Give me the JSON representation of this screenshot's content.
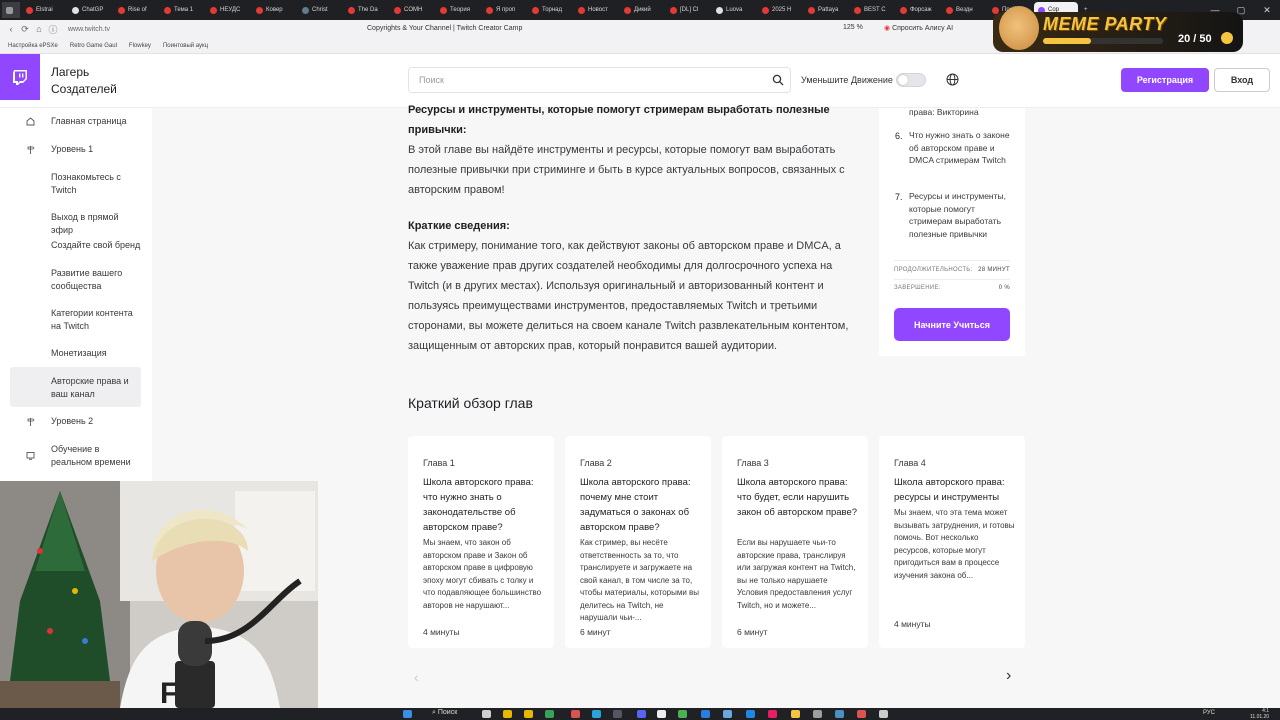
{
  "browser": {
    "tabs": [
      {
        "label": "Elstrai",
        "color": "#e53935"
      },
      {
        "label": "ChatGP",
        "color": "#e0e0e0"
      },
      {
        "label": "Rise of",
        "color": "#e53935"
      },
      {
        "label": "Тема 1",
        "color": "#e53935"
      },
      {
        "label": "НЕУДС",
        "color": "#e53935"
      },
      {
        "label": "Ковер",
        "color": "#e53935"
      },
      {
        "label": "Christ",
        "color": "#607d8b"
      },
      {
        "label": "The Da",
        "color": "#e53935"
      },
      {
        "label": "COMH",
        "color": "#e53935"
      },
      {
        "label": "Теория",
        "color": "#e53935"
      },
      {
        "label": "Я проп",
        "color": "#e53935"
      },
      {
        "label": "Торнад",
        "color": "#e53935"
      },
      {
        "label": "Новост",
        "color": "#e53935"
      },
      {
        "label": "Дикий",
        "color": "#e53935"
      },
      {
        "label": "[DL] Cl",
        "color": "#e53935"
      },
      {
        "label": "Luova",
        "color": "#e0e0e0"
      },
      {
        "label": "2025 H",
        "color": "#e53935"
      },
      {
        "label": "Pattaya",
        "color": "#e53935"
      },
      {
        "label": "BEST C",
        "color": "#e53935"
      },
      {
        "label": "Форсаж",
        "color": "#e53935"
      },
      {
        "label": "Вездн",
        "color": "#e53935"
      },
      {
        "label": "Пройд",
        "color": "#e53935"
      },
      {
        "label": "Cop",
        "color": "#9146ff"
      }
    ],
    "new_tab": "+",
    "url": "www.twitch.tv",
    "page_title": "Copyrights & Your Channel | Twitch Creator Camp",
    "zoom": "125 %",
    "ask_alice": "Спросить Алису AI",
    "bookmarks": [
      "Настройка ePSXe",
      "Retro Game Gaul",
      "Flowkey",
      "Поинтовый аукц"
    ]
  },
  "overlay": {
    "title": "MEME PARTY",
    "count": "20 / 50",
    "progress": 0.4
  },
  "header": {
    "site_name": "Лагерь Создателей",
    "search_placeholder": "Поиск",
    "reduce_motion_label": "Уменьшите Движение",
    "register_label": "Регистрация",
    "login_label": "Вход"
  },
  "sidebar": {
    "items": [
      {
        "label": "Главная страница",
        "icon": "home-icon"
      },
      {
        "label": "Уровень 1",
        "icon": "signpost-icon"
      },
      {
        "label": "Познакомьтесь с Twitch"
      },
      {
        "label": "Выход в прямой эфир"
      },
      {
        "label": "Создайте свой бренд"
      },
      {
        "label": "Развитие вашего сообщества"
      },
      {
        "label": "Категории контента на Twitch"
      },
      {
        "label": "Монетизация"
      },
      {
        "label": "Авторские права и ваш канал",
        "active": true
      },
      {
        "label": "Уровень 2",
        "icon": "signpost-icon"
      },
      {
        "label": "Обучение в реальном времени",
        "icon": "screen-icon"
      }
    ]
  },
  "main": {
    "section1_heading": "Ресурсы и инструменты, которые помогут стримерам выработать полезные привычки:",
    "section1_text": "В этой главе вы найдёте инструменты и ресурсы, которые помогут вам выработать полезные привычки при стриминге и быть в курсе актуальных вопросов, связанных с авторским правом!",
    "summary_heading": "Краткие сведения:",
    "summary_text": "Как стримеру, понимание того, как действуют законы об авторском праве и DMCA, а также уважение прав других создателей необходимы для долгосрочного успеха на Twitch (и в других местах). Используя оригинальный и авторизованный контент и пользуясь преимуществами инструментов, предоставляемых Twitch и третьими сторонами, вы можете делиться на своем канале Twitch развлекательным контентом, защищенным от авторских прав, который понравится вашей аудитории.",
    "chapters_title": "Краткий обзор глав",
    "chapters": [
      {
        "label": "Глава 1",
        "title": "Школа авторского права: что нужно знать о законодательстве об авторском праве?",
        "desc": "Мы знаем, что закон об авторском праве и Закон об авторском праве в цифровую эпоху могут сбивать с толку и что подавляющее большинство авторов не нарушают...",
        "duration": "4 минуты"
      },
      {
        "label": "Глава 2",
        "title": "Школа авторского права: почему мне стоит задуматься о законах об авторском праве?",
        "desc": "Как стример, вы несёте ответственность за то, что транслируете и загружаете на свой канал, в том числе за то, чтобы материалы, которыми вы делитесь на Twitch, не нарушали чьи-...",
        "duration": "6 минут"
      },
      {
        "label": "Глава 3",
        "title": "Школа авторского права: что будет, если нарушить закон об авторском праве?",
        "desc": "Если вы нарушаете чьи-то авторские права, транслируя или загружая контент на Twitch, вы не только нарушаете Условия предоставления услуг Twitch, но и можете...",
        "duration": "6 минут"
      },
      {
        "label": "Глава 4",
        "title": "Школа авторского права: ресурсы и инструменты",
        "desc": "Мы знаем, что эта тема может вызывать затруднения, и готовы помочь. Вот несколько ресурсов, которые могут пригодиться вам в процессе изучения закона об...",
        "duration": "4 минуты"
      }
    ],
    "prev_arrow": "‹",
    "next_arrow": "›"
  },
  "right_panel": {
    "toc_partial": "права: Викторина",
    "toc": [
      {
        "num": "6.",
        "text": "Что нужно знать о законе об авторском праве и DMCA стримерам Twitch"
      },
      {
        "num": "7.",
        "text": "Ресурсы и инструменты, которые помогут стримерам выработать полезные привычки"
      }
    ],
    "duration_label": "ПРОДОЛЖИТЕЛЬНОСТЬ:",
    "duration_value": "28 МИНУТ",
    "completion_label": "ЗАВЕРШЕНИЕ:",
    "completion_value": "0 %",
    "start_label": "Начните Учиться"
  },
  "taskbar": {
    "search_label": "Поиск",
    "lang": "РУС",
    "time": "4:1",
    "date": "11.01.20"
  },
  "colors": {
    "accent": "#9146ff",
    "page_bg": "#f7f7f8"
  }
}
